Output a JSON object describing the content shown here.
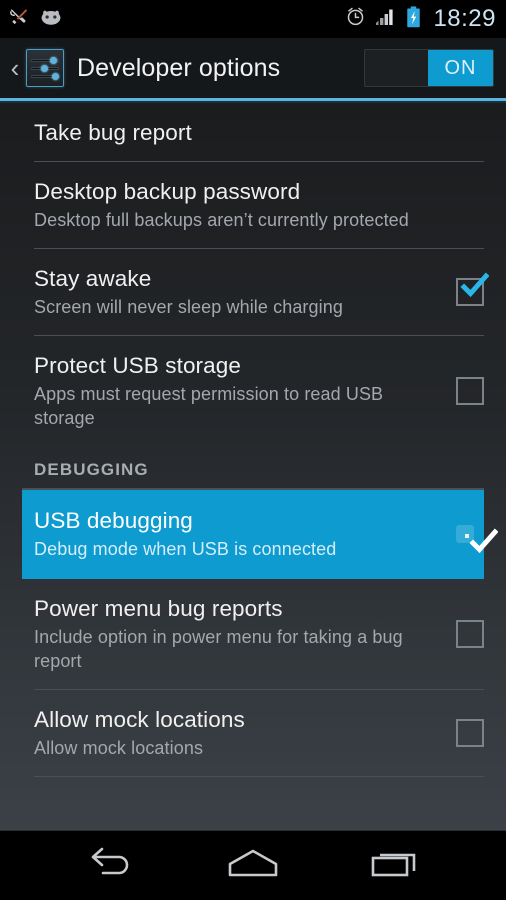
{
  "status_bar": {
    "icons": [
      "developer-tools-icon",
      "cyanogenmod-icon",
      "alarm-icon",
      "signal-icon",
      "battery-charging-icon"
    ],
    "clock": "18:29"
  },
  "action_bar": {
    "back_label": "‹",
    "icon": "developer-options-sliders-icon",
    "title": "Developer options",
    "toggle_label": "ON",
    "toggle_state": "on",
    "accent_color": "#0d9bd0",
    "underline_color": "#5db4dc"
  },
  "list": {
    "items": [
      {
        "name": "take-bug-report",
        "title": "Take bug report",
        "summary": "",
        "control": "none",
        "checked": false,
        "highlighted": false
      },
      {
        "name": "desktop-backup-password",
        "title": "Desktop backup password",
        "summary": "Desktop full backups aren’t currently protected",
        "control": "none",
        "checked": false,
        "highlighted": false
      },
      {
        "name": "stay-awake",
        "title": "Stay awake",
        "summary": "Screen will never sleep while charging",
        "control": "checkbox",
        "checked": true,
        "highlighted": false
      },
      {
        "name": "protect-usb-storage",
        "title": "Protect USB storage",
        "summary": "Apps must request permission to read USB storage",
        "control": "checkbox",
        "checked": false,
        "highlighted": false
      }
    ],
    "section": {
      "name": "debugging",
      "header": "DEBUGGING",
      "items": [
        {
          "name": "usb-debugging",
          "title": "USB debugging",
          "summary": "Debug mode when USB is connected",
          "control": "checkbox",
          "checked": true,
          "highlighted": true
        },
        {
          "name": "power-menu-bug-reports",
          "title": "Power menu bug reports",
          "summary": "Include option in power menu for taking a bug report",
          "control": "checkbox",
          "checked": false,
          "highlighted": false
        },
        {
          "name": "allow-mock-locations",
          "title": "Allow mock locations",
          "summary": "Allow mock locations",
          "control": "checkbox",
          "checked": false,
          "highlighted": false
        }
      ]
    }
  },
  "nav_bar": {
    "buttons": [
      {
        "name": "back-button",
        "icon": "back-arrow-icon"
      },
      {
        "name": "home-button",
        "icon": "home-icon"
      },
      {
        "name": "recents-button",
        "icon": "recents-icon"
      }
    ]
  }
}
